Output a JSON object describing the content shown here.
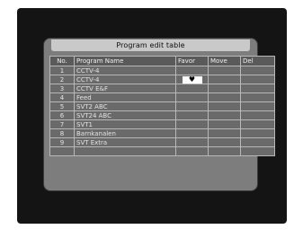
{
  "panel": {
    "title": "Program edit table"
  },
  "table": {
    "headers": {
      "no": "No.",
      "name": "Program Name",
      "favor": "Favor",
      "move": "Move",
      "del": "Del"
    },
    "rows": [
      {
        "no": "1",
        "name": "CCTV-4",
        "favor": false
      },
      {
        "no": "2",
        "name": "CCTV-4",
        "favor": true
      },
      {
        "no": "3",
        "name": "CCTV E&F",
        "favor": false
      },
      {
        "no": "4",
        "name": "Feed",
        "favor": false
      },
      {
        "no": "5",
        "name": "SVT2 ABC",
        "favor": false
      },
      {
        "no": "6",
        "name": "SVT24 ABC",
        "favor": false
      },
      {
        "no": "7",
        "name": "SVT1",
        "favor": false
      },
      {
        "no": "8",
        "name": "Barnkanalen",
        "favor": false
      },
      {
        "no": "9",
        "name": "SVT Extra",
        "favor": false
      }
    ],
    "empty_rows": 1
  },
  "icons": {
    "favor_mark": "heart-icon"
  }
}
